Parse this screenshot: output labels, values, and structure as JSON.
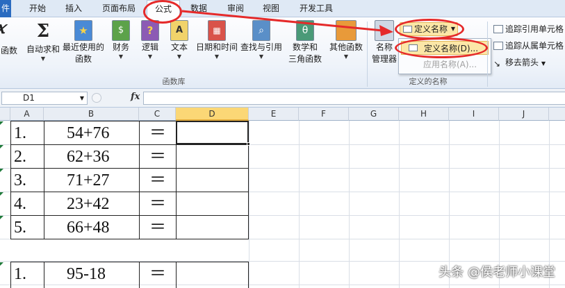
{
  "tabs": {
    "file": "件",
    "items": [
      "开始",
      "插入",
      "页面布局",
      "公式",
      "数据",
      "审阅",
      "视图",
      "开发工具"
    ],
    "active": "公式"
  },
  "ribbon": {
    "insert_fn_label": "函数",
    "buttons": [
      {
        "label1": "自动求和",
        "label2": "",
        "icon": "sigma-icon"
      },
      {
        "label1": "最近使用的",
        "label2": "函数",
        "icon": "star-book-icon"
      },
      {
        "label1": "财务",
        "label2": "",
        "icon": "finance-book-icon"
      },
      {
        "label1": "逻辑",
        "label2": "",
        "icon": "question-book-icon"
      },
      {
        "label1": "文本",
        "label2": "",
        "icon": "text-book-icon"
      },
      {
        "label1": "日期和时间",
        "label2": "",
        "icon": "date-book-icon"
      },
      {
        "label1": "查找与引用",
        "label2": "",
        "icon": "search-book-icon"
      },
      {
        "label1": "数学和",
        "label2": "三角函数",
        "icon": "theta-book-icon"
      },
      {
        "label1": "其他函数",
        "label2": "",
        "icon": "more-books-icon"
      }
    ],
    "group_fn_library": "函数库",
    "name_manager_1": "名称",
    "name_manager_2": "管理器",
    "define_name_btn": "定义名称",
    "dropdown_define": "定义名称(D)...",
    "dropdown_apply": "应用名称(A)...",
    "group_defined_names": "定义的名称",
    "trace_precedents": "追踪引用单元格",
    "trace_dependents": "追踪从属单元格",
    "remove_arrows": "移去箭头"
  },
  "formula_bar": {
    "name_box": "D1",
    "fx": "fx",
    "formula": ""
  },
  "grid": {
    "columns": [
      "A",
      "B",
      "C",
      "D",
      "E",
      "F",
      "G",
      "H",
      "I",
      "J"
    ],
    "selected_column": "D",
    "rows": [
      {
        "num": "1.",
        "expr": "54+76",
        "eq": "＝"
      },
      {
        "num": "2.",
        "expr": "62+36",
        "eq": "＝"
      },
      {
        "num": "3.",
        "expr": "71+27",
        "eq": "＝"
      },
      {
        "num": "4.",
        "expr": "23+42",
        "eq": "＝"
      },
      {
        "num": "5.",
        "expr": "66+48",
        "eq": "＝"
      },
      {
        "num": "1.",
        "expr": "95-18",
        "eq": "＝"
      }
    ]
  },
  "watermark": "头条 @侯老师小课堂",
  "colors": {
    "annotation": "#e52a2a",
    "highlight": "#fce7a7"
  }
}
